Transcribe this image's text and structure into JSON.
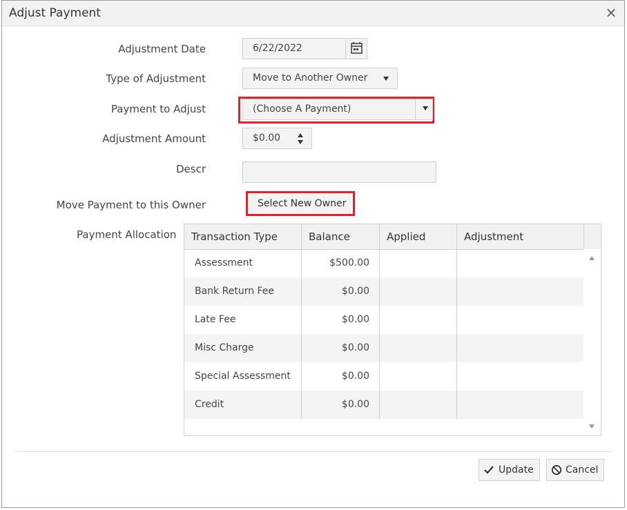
{
  "dialog": {
    "title": "Adjust Payment",
    "close_label": "×"
  },
  "form": {
    "adjustment_date": {
      "label": "Adjustment Date",
      "value": "6/22/2022"
    },
    "type_of_adjustment": {
      "label": "Type of Adjustment",
      "value": "Move to Another Owner"
    },
    "payment_to_adjust": {
      "label": "Payment to Adjust",
      "value": "(Choose A Payment)"
    },
    "adjustment_amount": {
      "label": "Adjustment Amount",
      "value": "$0.00"
    },
    "descr": {
      "label": "Descr",
      "value": ""
    },
    "move_payment": {
      "label": "Move Payment to this Owner",
      "button_label": "Select New Owner"
    },
    "allocation": {
      "label": "Payment Allocation"
    }
  },
  "grid": {
    "columns": [
      "Transaction Type",
      "Balance",
      "Applied",
      "Adjustment"
    ],
    "rows": [
      {
        "type": "Assessment",
        "balance": "$500.00",
        "applied": "",
        "adjustment": ""
      },
      {
        "type": "Bank Return Fee",
        "balance": "$0.00",
        "applied": "",
        "adjustment": ""
      },
      {
        "type": "Late Fee",
        "balance": "$0.00",
        "applied": "",
        "adjustment": ""
      },
      {
        "type": "Misc Charge",
        "balance": "$0.00",
        "applied": "",
        "adjustment": ""
      },
      {
        "type": "Special Assessment",
        "balance": "$0.00",
        "applied": "",
        "adjustment": ""
      },
      {
        "type": "Credit",
        "balance": "$0.00",
        "applied": "",
        "adjustment": ""
      }
    ]
  },
  "footer": {
    "update_label": "Update",
    "cancel_label": "Cancel"
  },
  "colors": {
    "highlight": "#e0212b"
  }
}
